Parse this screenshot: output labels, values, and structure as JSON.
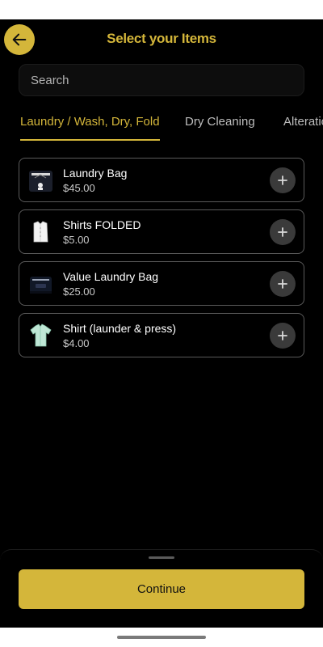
{
  "header": {
    "title": "Select your Items",
    "back_icon": "arrow-left-icon"
  },
  "search": {
    "placeholder": "Search",
    "value": ""
  },
  "tabs": [
    {
      "label": "Laundry / Wash, Dry, Fold",
      "active": true
    },
    {
      "label": "Dry Cleaning",
      "active": false
    },
    {
      "label": "Alterations",
      "active": false
    }
  ],
  "items": [
    {
      "name": "Laundry Bag",
      "price": "$45.00",
      "icon": "laundry-bag-icon"
    },
    {
      "name": "Shirts FOLDED",
      "price": "$5.00",
      "icon": "folded-shirt-icon"
    },
    {
      "name": "Value Laundry Bag",
      "price": "$25.00",
      "icon": "value-bag-icon"
    },
    {
      "name": "Shirt (launder & press)",
      "price": "$4.00",
      "icon": "pressed-shirt-icon"
    }
  ],
  "footer": {
    "continue_label": "Continue"
  },
  "colors": {
    "accent": "#d4b63a",
    "background": "#000000",
    "card_border": "#5a5a5a",
    "add_button": "#3a3a3a"
  }
}
